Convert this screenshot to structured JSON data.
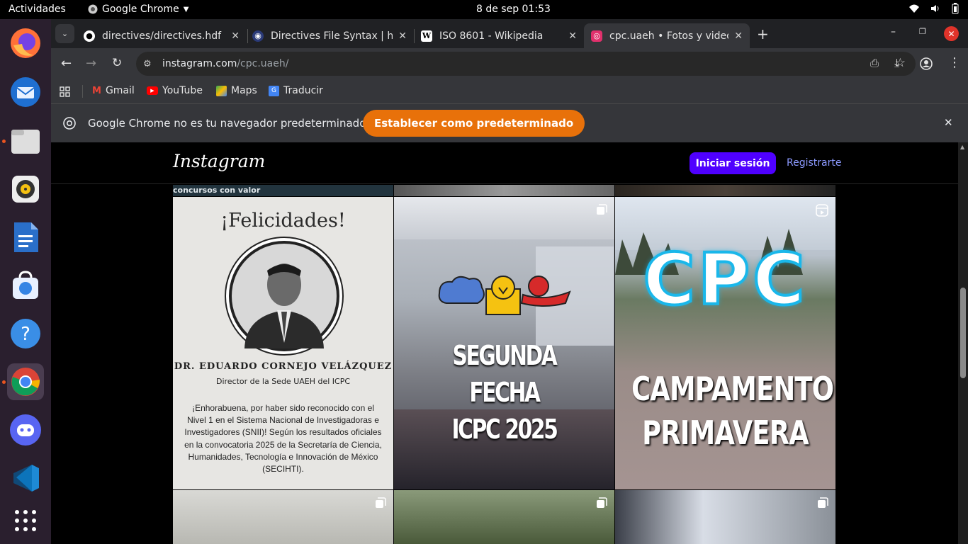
{
  "system": {
    "activities": "Actividades",
    "app_name": "Google Chrome",
    "datetime": "8 de sep  01:53"
  },
  "tabs": [
    {
      "title": "directives/directives.hdf",
      "icon": "github-icon"
    },
    {
      "title": "Directives File Syntax | h",
      "icon": "globe-icon"
    },
    {
      "title": "ISO 8601 - Wikipedia",
      "icon": "wikipedia-icon"
    },
    {
      "title": "cpc.uaeh • Fotos y videos",
      "icon": "instagram-icon"
    }
  ],
  "address": {
    "host": "instagram.com",
    "path": "/cpc.uaeh/"
  },
  "bookmarks": [
    "Gmail",
    "YouTube",
    "Maps",
    "Traducir"
  ],
  "infobar": {
    "message": "Google Chrome no es tu navegador predeterminado",
    "button": "Establecer como predeterminado"
  },
  "instagram": {
    "logo": "Instagram",
    "login": "Iniciar sesión",
    "signup": "Registrarte",
    "top_caption": "concursos con valor"
  },
  "posts": {
    "felicidades": {
      "heading": "¡Felicidades!",
      "name": "DR. EDUARDO CORNEJO VELÁZQUEZ",
      "role": "Director de la Sede UAEH del ICPC",
      "body_lines": [
        "¡Enhorabuena, por haber sido reconocido con el",
        "Nivel 1 en el Sistema Nacional de Investigadoras e",
        "Investigadores (SNII)! Según los resultados oficiales",
        "en la convocatoria 2025 de la Secretaría de Ciencia,",
        "Humanidades, Tecnología e Innovación de México",
        "(SECIHTI)."
      ]
    },
    "segunda": {
      "line1": "SEGUNDA FECHA",
      "line2": "ICPC 2025"
    },
    "campamento": {
      "logo": "CPC",
      "line1": "CAMPAMENTO DE",
      "line2": "PRIMAVERA"
    }
  },
  "colors": {
    "accent_button": "#4f00ff",
    "infobar_button": "#e8710a",
    "link": "#8c9aff"
  }
}
